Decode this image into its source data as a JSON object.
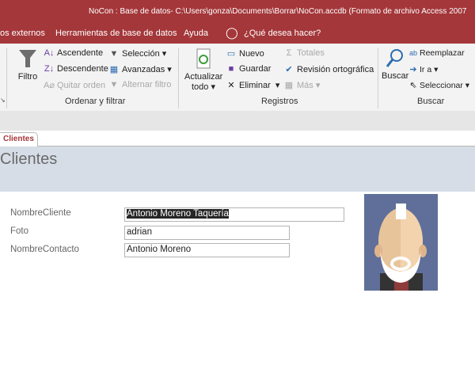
{
  "window": {
    "title": "NoCon : Base de datos- C:\\Users\\gonza\\Documents\\Borrar\\NoCon.accdb (Formato de archivo Access 2007"
  },
  "menu": {
    "items": [
      "os externos",
      "Herramientas de base de datos",
      "Ayuda"
    ],
    "tell_me": "¿Qué desea hacer?"
  },
  "ribbon": {
    "sort_filter": {
      "filter": "Filtro",
      "ascending": "Ascendente",
      "descending": "Descendente",
      "clear_sort": "Quitar orden",
      "selection": "Selección",
      "advanced": "Avanzadas",
      "toggle_filter": "Alternar filtro",
      "group_label": "Ordenar y filtrar"
    },
    "records": {
      "refresh_line1": "Actualizar",
      "refresh_line2": "todo",
      "new": "Nuevo",
      "save": "Guardar",
      "delete": "Eliminar",
      "totals": "Totales",
      "spelling": "Revisión ortográfica",
      "more": "Más",
      "group_label": "Registros"
    },
    "find": {
      "find": "Buscar",
      "replace": "Reemplazar",
      "goto": "Ir a",
      "select": "Seleccionar",
      "group_label": "Buscar"
    }
  },
  "document_tab": {
    "label": "Clientes"
  },
  "form": {
    "title": "Clientes",
    "fields": [
      {
        "label": "NombreCliente",
        "value": "Antonio Moreno Taquería"
      },
      {
        "label": "Foto",
        "value": "adrian"
      },
      {
        "label": "NombreContacto",
        "value": "Antonio Moreno"
      }
    ]
  },
  "colors": {
    "accent": "#a4373a",
    "form_header": "#d6dde6"
  }
}
